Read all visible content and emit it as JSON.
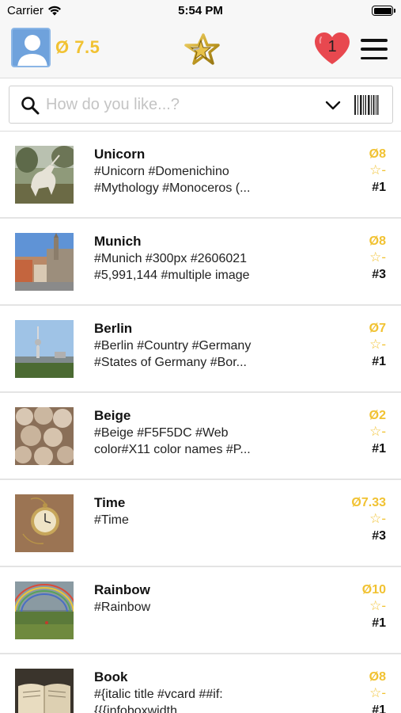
{
  "status_bar": {
    "carrier": "Carrier",
    "time": "5:54 PM"
  },
  "header": {
    "avg_rating": "Ø 7.5",
    "likes_count": "1"
  },
  "search": {
    "placeholder": "How do you like...?",
    "value": ""
  },
  "items": [
    {
      "title": "Unicorn",
      "tags": "#Unicorn #Domenichino\n#Mythology #Monoceros (...",
      "avg": "Ø8",
      "my_rating": "☆-",
      "rank": "#1",
      "image": "unicorn painting"
    },
    {
      "title": "Munich",
      "tags": "#Munich #300px #2606021\n#5,991,144 #multiple image",
      "avg": "Ø8",
      "my_rating": "☆-",
      "rank": "#3",
      "image": "munich city hall"
    },
    {
      "title": "Berlin",
      "tags": "#Berlin #Country #Germany\n#States of Germany #Bor...",
      "avg": "Ø7",
      "my_rating": "☆-",
      "rank": "#1",
      "image": "berlin tv tower"
    },
    {
      "title": "Beige",
      "tags": "#Beige #F5F5DC #Web\ncolor#X11 color names #P...",
      "avg": "Ø2",
      "my_rating": "☆-",
      "rank": "#1",
      "image": "beige wool"
    },
    {
      "title": "Time",
      "tags": "#Time",
      "avg": "Ø7.33",
      "my_rating": "☆-",
      "rank": "#3",
      "image": "pocket watch"
    },
    {
      "title": "Rainbow",
      "tags": "#Rainbow",
      "avg": "Ø10",
      "my_rating": "☆-",
      "rank": "#1",
      "image": "rainbow landscape"
    },
    {
      "title": "Book",
      "tags": "#{italic title #vcard ##if:\n{{{infoboxwidth",
      "avg": "Ø8",
      "my_rating": "☆-",
      "rank": "#1",
      "image": "open book"
    }
  ],
  "colors": {
    "accent": "#f1c232",
    "heart": "#e8484f",
    "avatar": "#6fa2dc"
  }
}
